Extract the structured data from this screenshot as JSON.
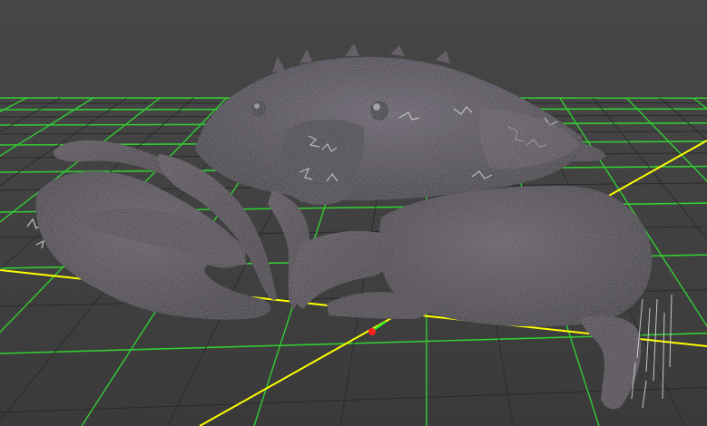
{
  "viewport": {
    "background_color": "#444444",
    "subject": "crab-3d-model",
    "grid": {
      "visible": true,
      "major_line_color": "#33cc33",
      "minor_line_color": "#2a2a2a",
      "x_axis_color": "#ffff00",
      "z_axis_color": "#ffff00"
    },
    "gizmo": {
      "origin_marker_color": "#ff2020",
      "y_axis_color": "#20ff20"
    }
  }
}
